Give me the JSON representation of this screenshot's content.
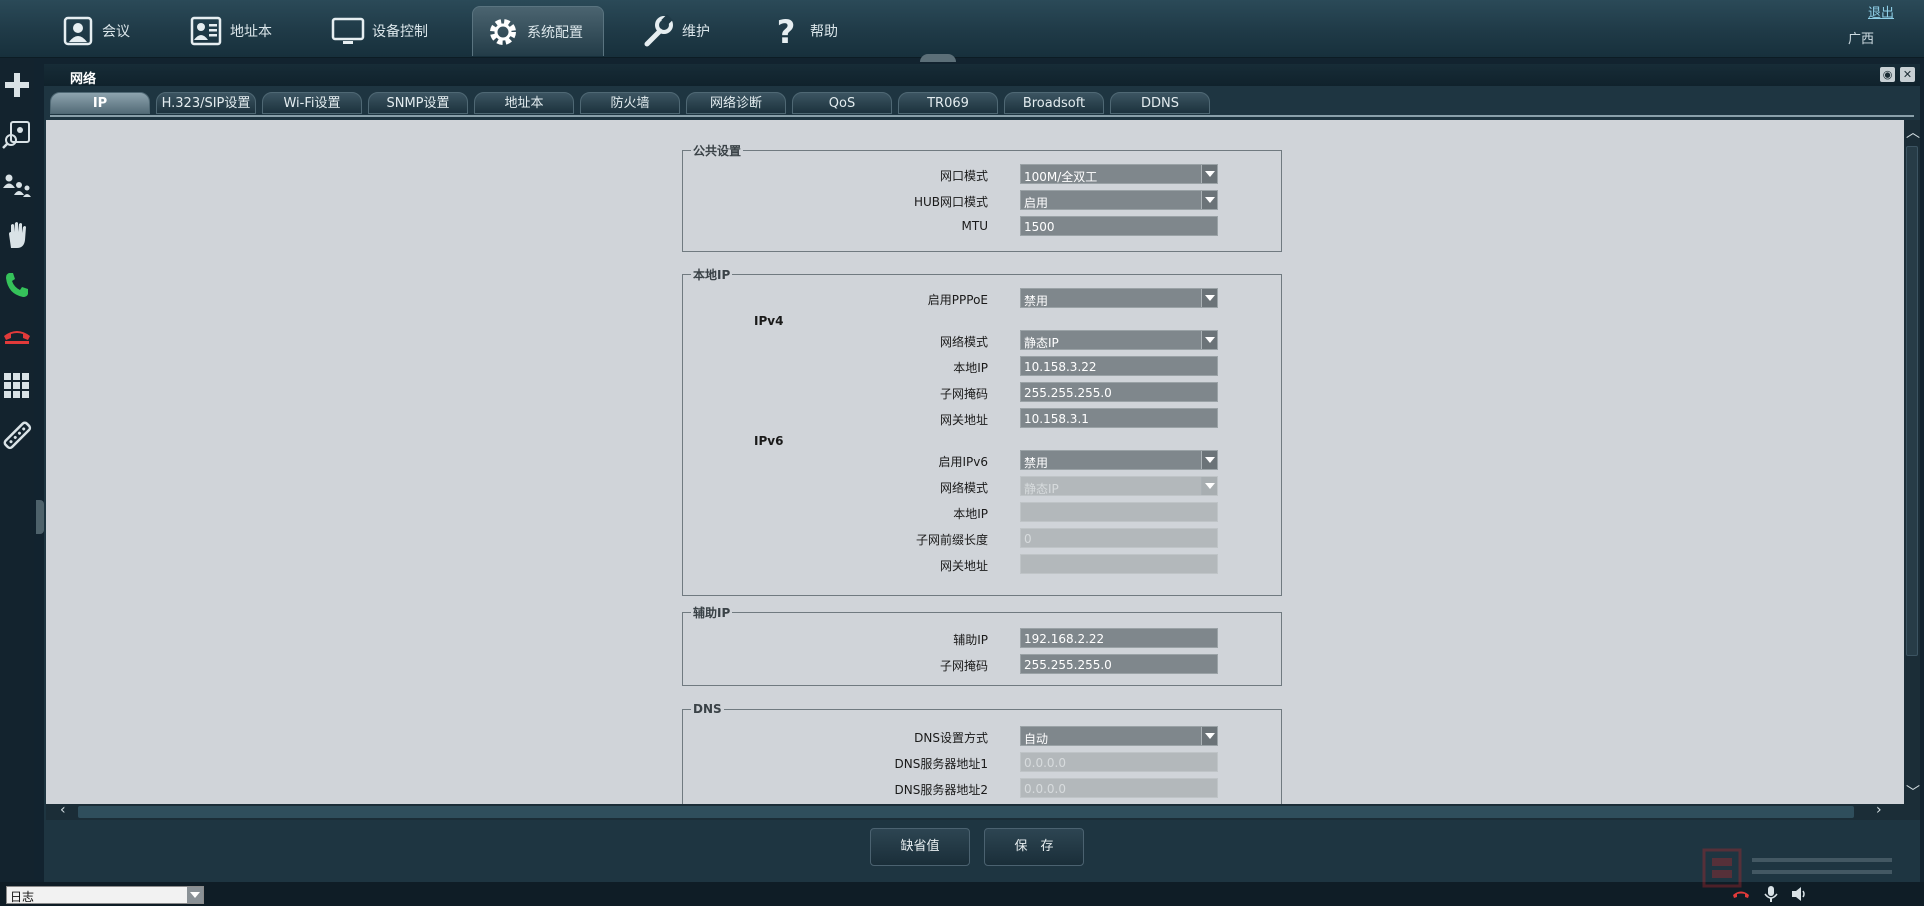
{
  "nav": {
    "items": [
      {
        "label": "会议",
        "icon": "meeting-icon"
      },
      {
        "label": "地址本",
        "icon": "address-book-icon"
      },
      {
        "label": "设备控制",
        "icon": "monitor-icon"
      },
      {
        "label": "系统配置",
        "icon": "gear-icon"
      },
      {
        "label": "维护",
        "icon": "wrench-icon"
      },
      {
        "label": "帮助",
        "icon": "question-icon"
      }
    ],
    "active": "系统配置",
    "logout": "退出",
    "region": "广西"
  },
  "panel": {
    "title": "网络",
    "tabs": [
      "IP",
      "H.323/SIP设置",
      "Wi-Fi设置",
      "SNMP设置",
      "地址本",
      "防火墙",
      "网络诊断",
      "QoS",
      "TR069",
      "Broadsoft",
      "DDNS"
    ],
    "active_tab": "IP"
  },
  "public": {
    "legend": "公共设置",
    "port_mode_label": "网口模式",
    "port_mode_value": "100M/全双工",
    "hub_label": "HUB网口模式",
    "hub_value": "启用",
    "mtu_label": "MTU",
    "mtu_value": "1500"
  },
  "local": {
    "legend": "本地IP",
    "pppoe_label": "启用PPPoE",
    "pppoe_value": "禁用",
    "ipv4": "IPv4",
    "v4_mode_label": "网络模式",
    "v4_mode_value": "静态IP",
    "v4_ip_label": "本地IP",
    "v4_ip_value": "10.158.3.22",
    "v4_mask_label": "子网掩码",
    "v4_mask_value": "255.255.255.0",
    "v4_gw_label": "网关地址",
    "v4_gw_value": "10.158.3.1",
    "ipv6": "IPv6",
    "v6_enable_label": "启用IPv6",
    "v6_enable_value": "禁用",
    "v6_mode_label": "网络模式",
    "v6_mode_value": "静态IP",
    "v6_ip_label": "本地IP",
    "v6_ip_value": "",
    "v6_prefix_label": "子网前缀长度",
    "v6_prefix_value": "0",
    "v6_gw_label": "网关地址",
    "v6_gw_value": ""
  },
  "aux": {
    "legend": "辅助IP",
    "ip_label": "辅助IP",
    "ip_value": "192.168.2.22",
    "mask_label": "子网掩码",
    "mask_value": "255.255.255.0"
  },
  "dns": {
    "legend": "DNS",
    "mode_label": "DNS设置方式",
    "mode_value": "自动",
    "srv1_label": "DNS服务器地址1",
    "srv1_value": "0.0.0.0",
    "srv2_label": "DNS服务器地址2",
    "srv2_value": "0.0.0.0"
  },
  "buttons": {
    "default": "缺省值",
    "save": "保　存"
  },
  "status": {
    "log": "日志"
  },
  "colors": {
    "accent": "#2b4a58",
    "content_bg": "#d0d4d9",
    "field_bg": "#7f878c"
  }
}
